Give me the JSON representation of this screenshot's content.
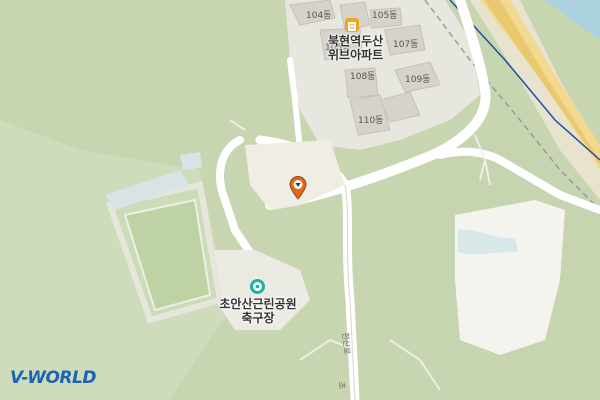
{
  "map": {
    "provider_logo": "V-WORLD",
    "apartment_complex": {
      "name_line1": "북현역두산",
      "name_line2": "위브아파트",
      "icon": "apartment-icon",
      "buildings": [
        "104동",
        "105동",
        "105동",
        "107동",
        "108동",
        "109동",
        "110동"
      ]
    },
    "poi": {
      "name_line1": "초안산근린공원",
      "name_line2": "축구장",
      "icon": "soccer-icon"
    },
    "marker": {
      "icon": "location-pin-icon"
    },
    "road_labels": [
      "한산로",
      "초"
    ],
    "colors": {
      "park": "#c9d6b3",
      "forest": "#bfcfa7",
      "urban": "#f1f0ea",
      "road": "#ffffff",
      "highway": "#f2d98d",
      "river": "#aad3df",
      "rail": "#1f4fa3",
      "marker": "#e06a1c",
      "poi_icon": "#1bb3a5"
    }
  }
}
